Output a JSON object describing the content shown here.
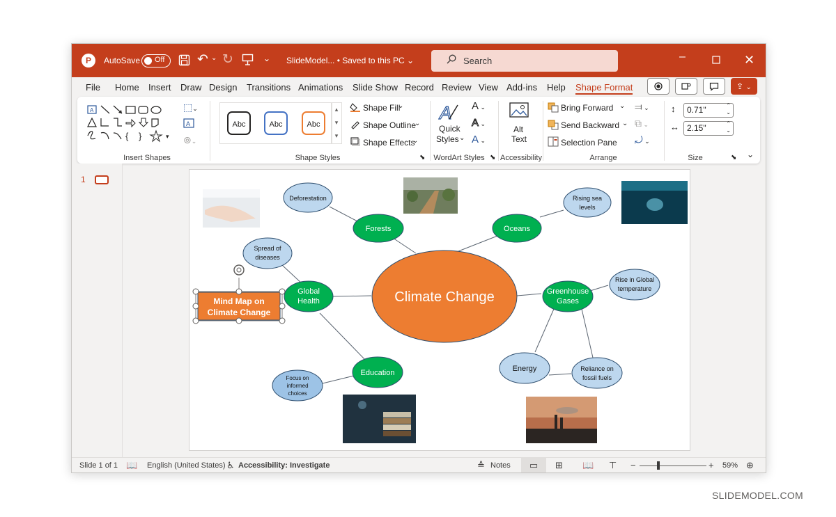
{
  "titlebar": {
    "autosave_label": "AutoSave",
    "autosave_state": "Off",
    "doc_title": "SlideModel... • Saved to this PC ⌄",
    "search_placeholder": "Search"
  },
  "menu": {
    "items": [
      "File",
      "Home",
      "Insert",
      "Draw",
      "Design",
      "Transitions",
      "Animations",
      "Slide Show",
      "Record",
      "Review",
      "View",
      "Add-ins",
      "Help",
      "Shape Format"
    ],
    "active": "Shape Format"
  },
  "ribbon": {
    "groups": {
      "insert_shapes": "Insert Shapes",
      "shape_styles": "Shape Styles",
      "wordart_styles": "WordArt Styles",
      "accessibility": "Accessibility",
      "arrange": "Arrange",
      "size": "Size"
    },
    "style_sample": "Abc",
    "shape_fill": "Shape Fill",
    "shape_outline": "Shape Outline",
    "shape_effects": "Shape Effects",
    "quick_styles_line1": "Quick",
    "quick_styles_line2": "Styles",
    "alt_text_line1": "Alt",
    "alt_text_line2": "Text",
    "bring_forward": "Bring Forward",
    "send_backward": "Send Backward",
    "selection_pane": "Selection Pane",
    "height_value": "0.71\"",
    "width_value": "2.15\""
  },
  "thumbnail": {
    "slide_number": "1"
  },
  "slide": {
    "center": "Climate Change",
    "title_box_line1": "Mind Map on",
    "title_box_line2": "Climate Change",
    "nodes": {
      "forests": "Forests",
      "oceans": "Oceans",
      "global_health_1": "Global",
      "global_health_2": "Health",
      "greenhouse_1": "Greenhouse",
      "greenhouse_2": "Gases",
      "education": "Education",
      "deforestation": "Deforestation",
      "rising_1": "Rising sea",
      "rising_2": "levels",
      "spread_1": "Spread of",
      "spread_2": "diseases",
      "rise_1": "Rise in Global",
      "rise_2": "temperature",
      "energy": "Energy",
      "reliance_1": "Reliance on",
      "reliance_2": "fossil fuels",
      "focus_1": "Focus on",
      "focus_2": "informed",
      "focus_3": "choices"
    }
  },
  "status": {
    "slide_info": "Slide 1 of 1",
    "language": "English (United States)",
    "accessibility": "Accessibility: Investigate",
    "notes": "Notes",
    "zoom": "59%"
  },
  "watermark": "SLIDEMODEL.COM",
  "colors": {
    "accent": "#c43e1c",
    "center_fill": "#ed7d31",
    "main_node_fill": "#00b050",
    "sub_node_fill": "#bdd7ee",
    "node_stroke": "#2f4f6f"
  }
}
